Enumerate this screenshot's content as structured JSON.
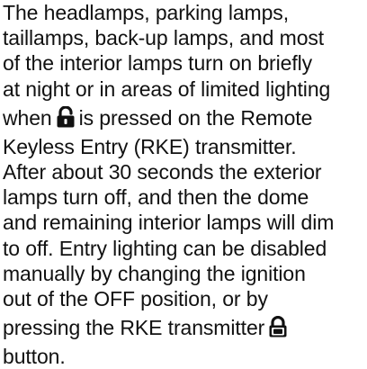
{
  "paragraph": {
    "line1": "The headlamps, parking lamps,",
    "line2": "taillamps, back-up lamps, and most",
    "line3": "of the interior lamps turn on briefly",
    "line4": "at night or in areas of limited lighting",
    "line5_before": "when",
    "line5_after": "is pressed on the Remote",
    "line6": "Keyless Entry (RKE) transmitter.",
    "line7": "After about 30 seconds the exterior",
    "line8": "lamps turn off, and then the dome",
    "line9": "and remaining interior lamps will dim",
    "line10": "to off. Entry lighting can be disabled",
    "line11": "manually by changing the ignition",
    "line12": "out of the OFF position, or by",
    "line13_before": "pressing the RKE transmitter",
    "line14": "button."
  },
  "icons": {
    "unlock": "unlock-padlock-icon",
    "lock": "lock-padlock-icon"
  },
  "colors": {
    "text": "#111111",
    "icon": "#111111"
  }
}
